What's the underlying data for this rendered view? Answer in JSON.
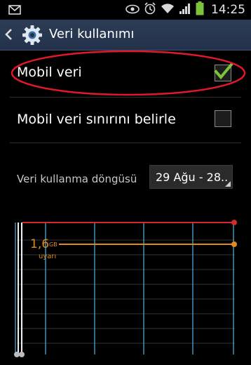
{
  "status_bar": {
    "time": "14:25",
    "icons": [
      "mail-icon",
      "eye-icon",
      "alarm-icon",
      "wifi-icon",
      "signal-icon",
      "battery-icon"
    ]
  },
  "action_bar": {
    "title": "Veri kullanımı",
    "back_icon": "chevron-left-icon",
    "app_icon": "gear-icon"
  },
  "settings": {
    "mobile_data": {
      "label": "Mobil veri",
      "checked": true
    },
    "limit": {
      "label": "Mobil veri sınırını belirle",
      "checked": false
    }
  },
  "cycle": {
    "label": "Veri kullanma döngüsü",
    "value": "29 Ağu - 28.."
  },
  "chart": {
    "warning_value": "1,6",
    "warning_unit": "GB",
    "warning_label": "uyarı",
    "limit_color": "#d42a2a",
    "warning_color": "#e08a1e",
    "grid_color": "#4fb6e8"
  },
  "highlight_color": "#e0192a"
}
